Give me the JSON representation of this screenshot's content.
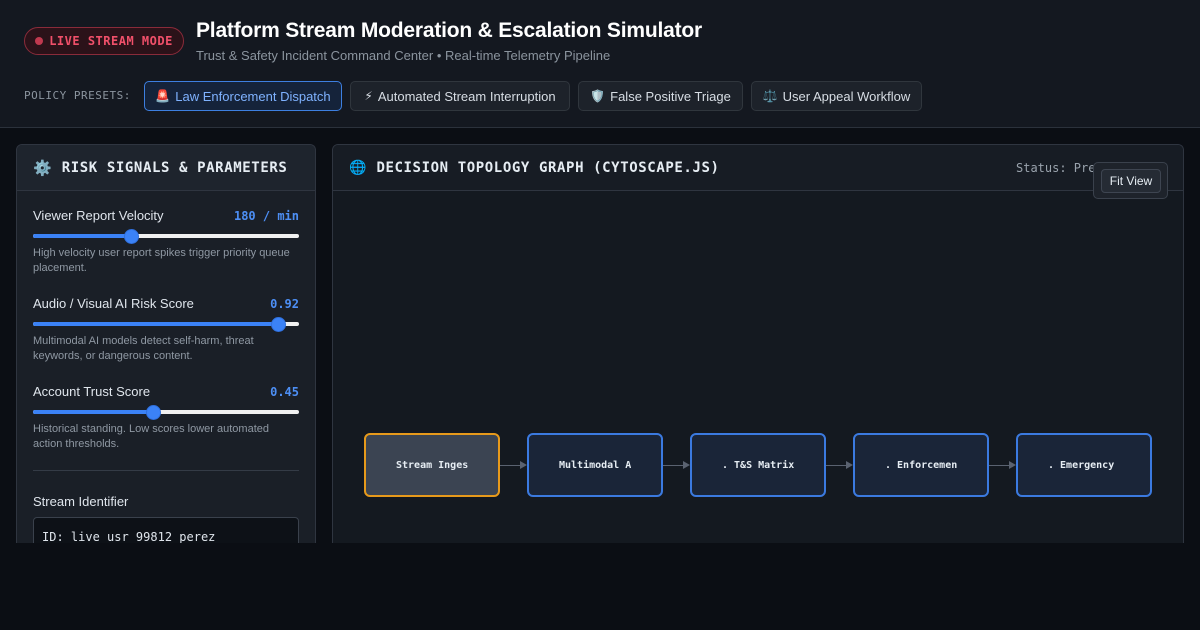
{
  "header": {
    "live_badge": "LIVE STREAM MODE",
    "title": "Platform Stream Moderation & Escalation Simulator",
    "subtitle": "Trust & Safety Incident Command Center • Real-time Telemetry Pipeline",
    "presets_label": "POLICY PRESETS:",
    "presets": [
      {
        "icon": "🚨",
        "label": "Law Enforcement Dispatch",
        "active": true
      },
      {
        "icon": "⚡",
        "label": "Automated Stream Interruption",
        "active": false
      },
      {
        "icon": "🛡️",
        "label": "False Positive Triage",
        "active": false
      },
      {
        "icon": "⚖️",
        "label": "User Appeal Workflow",
        "active": false
      }
    ]
  },
  "parameters": {
    "title": "RISK SIGNALS & PARAMETERS",
    "velocity": {
      "label": "Viewer Report Velocity",
      "value": "180 / min",
      "level": 0.37,
      "description": "High velocity user report spikes trigger priority queue placement."
    },
    "ai_risk": {
      "label": "Audio / Visual AI Risk Score",
      "value": "0.92",
      "level": 0.92,
      "description": "Multimodal AI models detect self-harm, threat keywords, or dangerous content."
    },
    "trust": {
      "label": "Account Trust Score",
      "value": "0.45",
      "level": 0.45,
      "description": "Historical standing. Low scores lower automated action thresholds."
    },
    "stream_identifier": {
      "label": "Stream Identifier",
      "value": "ID: live_usr_99812_perez"
    }
  },
  "graph": {
    "title": "DECISION TOPOLOGY GRAPH (CYTOSCAPE.JS)",
    "status": "Status: Pre",
    "fit_view_label": "Fit View",
    "nodes": [
      {
        "label": "Stream Ingestion",
        "selected": true
      },
      {
        "label": "Multimodal AI",
        "selected": false
      },
      {
        "label": ". T&S Matrix",
        "selected": false
      },
      {
        "label": ". Enforcement",
        "selected": false
      },
      {
        "label": ". Emergency P",
        "selected": false
      }
    ]
  },
  "colors": {
    "accent": "#3b82f6",
    "live": "#f0506a",
    "selected_node": "#e79a1b",
    "background": "#0b0e14"
  }
}
